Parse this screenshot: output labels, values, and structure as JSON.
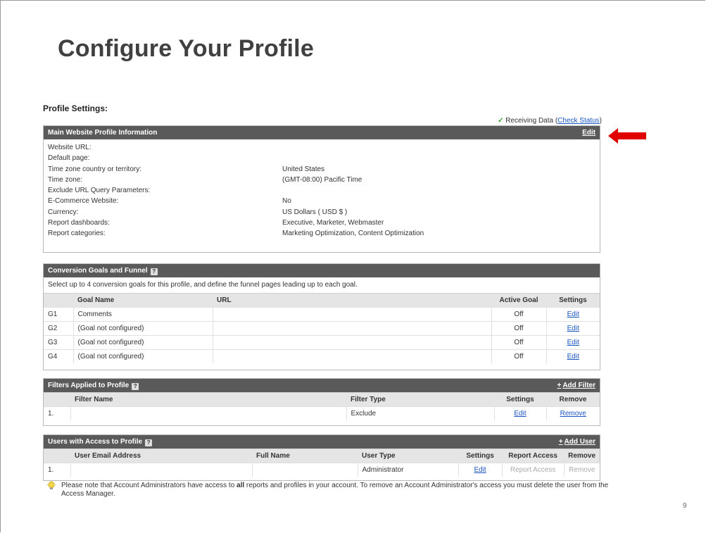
{
  "slide": {
    "title": "Configure Your Profile",
    "page_number": "9"
  },
  "shot": {
    "section_title": "Profile Settings:",
    "receiving": {
      "check_icon": "checkmark-icon",
      "text": "Receiving Data (",
      "link": "Check Status",
      "close": ")"
    },
    "main_profile": {
      "header": "Main Website Profile Information",
      "edit_label": "Edit",
      "rows": [
        {
          "label": "Website URL:",
          "value": ""
        },
        {
          "label": "Default page:",
          "value": ""
        },
        {
          "label": "Time zone country or territory:",
          "value": "United States"
        },
        {
          "label": "Time zone:",
          "value": "(GMT-08:00) Pacific Time"
        },
        {
          "label": "Exclude URL Query Parameters:",
          "value": ""
        },
        {
          "label": "E-Commerce Website:",
          "value": "No"
        },
        {
          "label": "Currency:",
          "value": "US Dollars ( USD $ )"
        },
        {
          "label": "Report dashboards:",
          "value": "Executive, Marketer, Webmaster"
        },
        {
          "label": "Report categories:",
          "value": "Marketing Optimization, Content Optimization"
        }
      ]
    },
    "goals": {
      "header": "Conversion Goals and Funnel",
      "help_icon": "?",
      "intro": "Select up to 4 conversion goals for this profile, and define the funnel pages leading up to each goal.",
      "columns": {
        "name": "Goal Name",
        "url": "URL",
        "active": "Active Goal",
        "settings": "Settings"
      },
      "rows": [
        {
          "id": "G1",
          "name": "Comments",
          "url": "",
          "active": "Off",
          "edit": "Edit"
        },
        {
          "id": "G2",
          "name": "(Goal not configured)",
          "url": "",
          "active": "Off",
          "edit": "Edit"
        },
        {
          "id": "G3",
          "name": "(Goal not configured)",
          "url": "",
          "active": "Off",
          "edit": "Edit"
        },
        {
          "id": "G4",
          "name": "(Goal not configured)",
          "url": "",
          "active": "Off",
          "edit": "Edit"
        }
      ]
    },
    "filters": {
      "header": "Filters Applied to Profile",
      "help_icon": "?",
      "add_plus": "+",
      "add_label": "Add Filter",
      "columns": {
        "name": "Filter Name",
        "type": "Filter Type",
        "settings": "Settings",
        "remove": "Remove"
      },
      "rows": [
        {
          "num": "1.",
          "name": "",
          "type": "Exclude",
          "edit": "Edit",
          "remove": "Remove"
        }
      ]
    },
    "users": {
      "header": "Users with Access to Profile",
      "help_icon": "?",
      "add_plus": "+",
      "add_label": "Add User",
      "columns": {
        "email": "User Email Address",
        "full_name": "Full Name",
        "type": "User Type",
        "settings": "Settings",
        "report_access": "Report Access",
        "remove": "Remove"
      },
      "rows": [
        {
          "num": "1.",
          "email": "",
          "full_name": "",
          "type": "Administrator",
          "edit": "Edit",
          "report_access": "Report Access",
          "remove": "Remove"
        }
      ]
    },
    "note": {
      "icon": "lightbulb-icon",
      "before": "Please note that Account Administrators have access to ",
      "bold": "all",
      "after": " reports and profiles in your account. To remove an Account Administrator's access you must delete the user from the Access Manager."
    }
  },
  "colors": {
    "arrow": "#e00000",
    "header_bar": "#5a5a5a",
    "link": "#1a55c4"
  }
}
